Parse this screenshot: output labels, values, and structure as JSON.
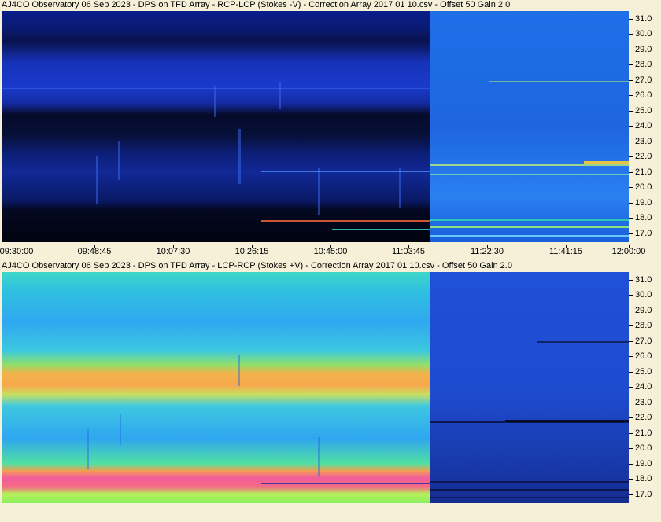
{
  "chart_data": [
    {
      "type": "heatmap",
      "title": "AJ4CO Observatory 06 Sep 2023 -  DPS on TFD Array  -  RCP-LCP (Stokes -V)  -  Correction Array 2017 01 10.csv  -  Offset 50  Gain 2.0",
      "x_ticks": [
        "09:30:00",
        "09:48:45",
        "10:07:30",
        "10:26:15",
        "10:45:00",
        "11:03:45",
        "11:22:30",
        "11:41:15",
        "12:00:00"
      ],
      "y_ticks": [
        "17.0",
        "18.0",
        "19.0",
        "20.0",
        "21.0",
        "22.0",
        "23.0",
        "24.0",
        "25.0",
        "26.0",
        "27.0",
        "28.0",
        "29.0",
        "30.0",
        "31.0"
      ],
      "ylim": [
        16.5,
        31.6
      ],
      "y_scale": "linear"
    },
    {
      "type": "heatmap",
      "title": "AJ4CO Observatory 06 Sep 2023 -  DPS on TFD Array  -  LCP-RCP (Stokes +V)  -  Correction Array 2017 01 10.csv  -  Offset 50  Gain 2.0",
      "x_ticks": [],
      "y_ticks": [
        "17.0",
        "18.0",
        "19.0",
        "20.0",
        "21.0",
        "22.0",
        "23.0",
        "24.0",
        "25.0",
        "26.0",
        "27.0",
        "28.0",
        "29.0",
        "30.0",
        "31.0"
      ],
      "ylim": [
        16.5,
        31.6
      ],
      "y_scale": "linear"
    }
  ]
}
